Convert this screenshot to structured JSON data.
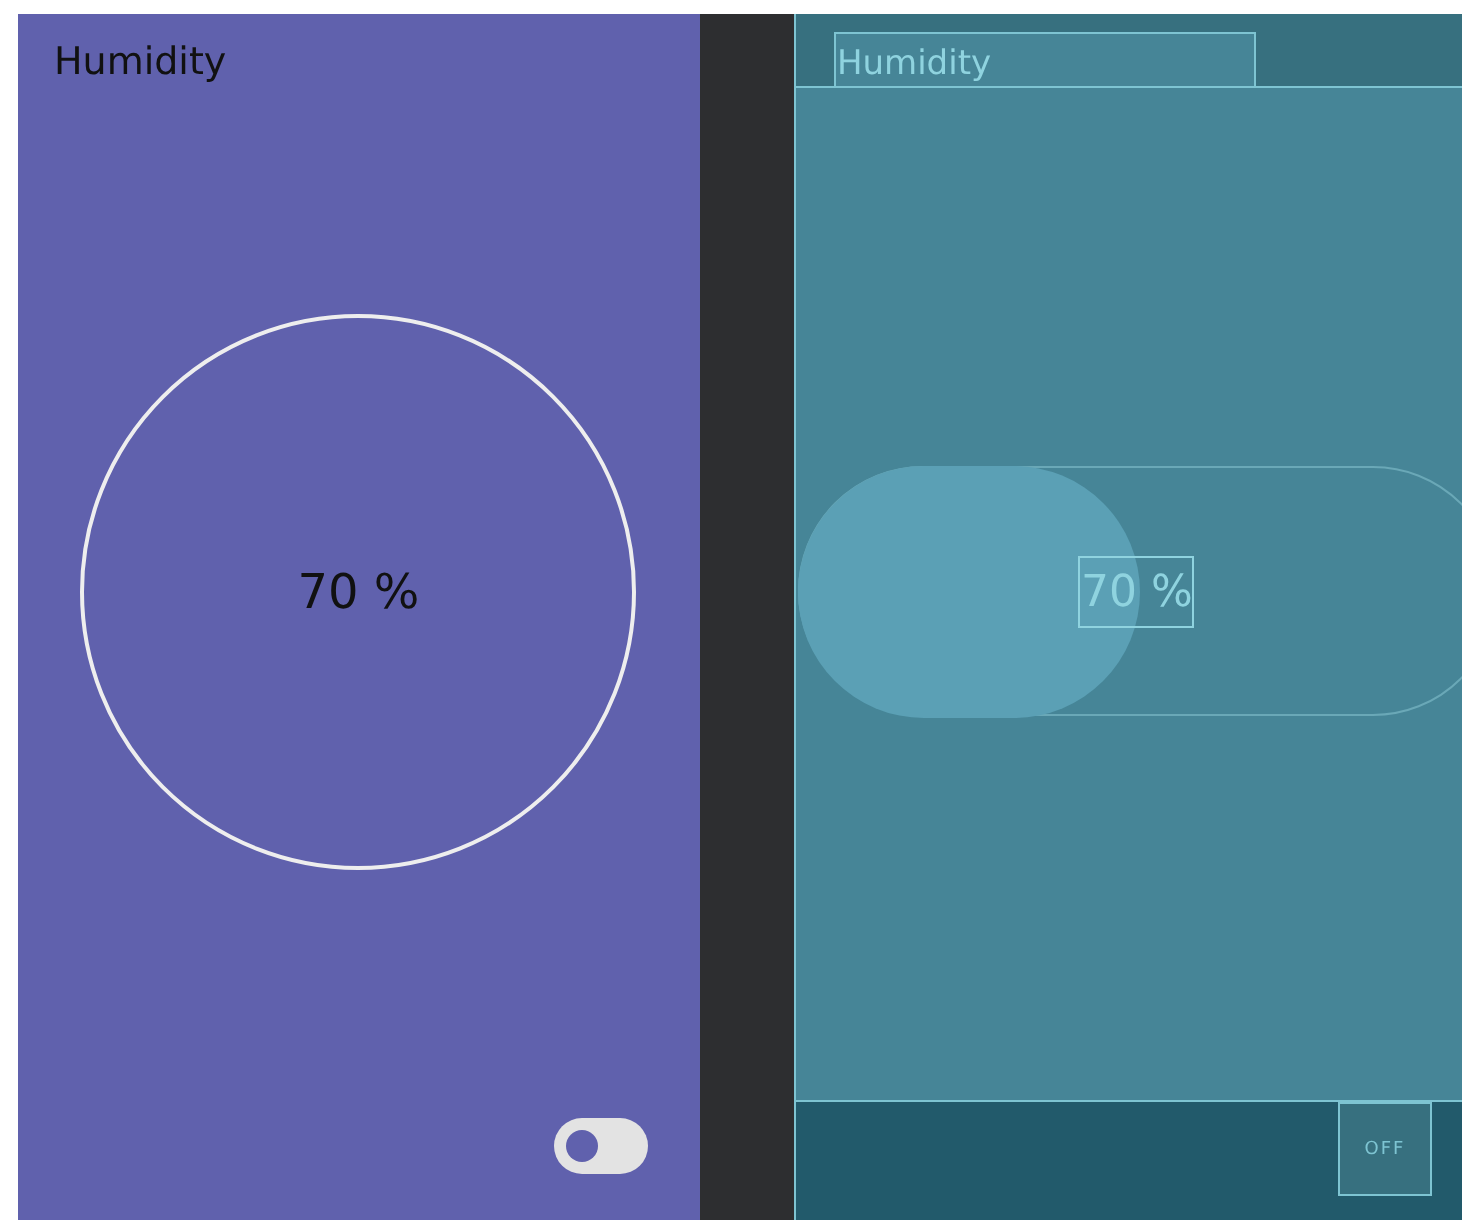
{
  "design": {
    "title": "Humidity",
    "reading": "70 %",
    "switch": {
      "on": false
    }
  },
  "blueprint": {
    "title": "Humidity",
    "reading": "70 %",
    "switch": {
      "label": "OFF",
      "on": false
    }
  }
}
